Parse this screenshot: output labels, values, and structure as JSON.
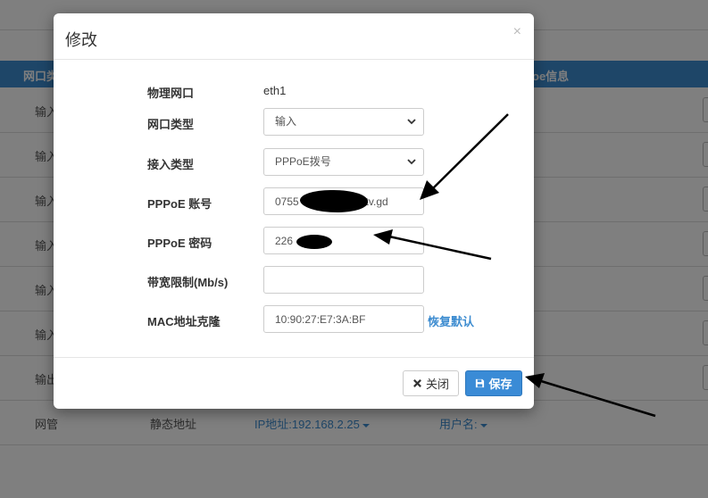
{
  "background": {
    "header_cols": [
      "网口类",
      "oe信息"
    ],
    "rows": [
      {
        "c1": "输入"
      },
      {
        "c1": "输入"
      },
      {
        "c1": "输入"
      },
      {
        "c1": "输入"
      },
      {
        "c1": "输入"
      },
      {
        "c1": "输入"
      },
      {
        "c1": "输出"
      },
      {
        "c1": "网管",
        "c2": "静态地址",
        "c3": "IP地址:192.168.2.25",
        "c4": "用户名:"
      }
    ]
  },
  "modal": {
    "title": "修改",
    "close_glyph": "×",
    "fields": {
      "physical_port": {
        "label": "物理网口",
        "value": "eth1"
      },
      "port_type": {
        "label": "网口类型",
        "value": "输入"
      },
      "access_type": {
        "label": "接入类型",
        "value": "PPPoE拨号"
      },
      "pppoe_account": {
        "label": "PPPoE 账号",
        "value": "0755                @iptv.gd"
      },
      "pppoe_password": {
        "label": "PPPoE 密码",
        "value": "226"
      },
      "bandwidth": {
        "label": "带宽限制(Mb/s)",
        "value": ""
      },
      "mac_clone": {
        "label": "MAC地址克隆",
        "value": "10:90:27:E7:3A:BF",
        "link": "恢复默认"
      }
    },
    "buttons": {
      "close": "关闭",
      "save": "保存"
    }
  },
  "colors": {
    "primary": "#3a8bd6",
    "table_header": "#3d8cd0",
    "overlay": "rgba(0,0,0,0.5)"
  }
}
